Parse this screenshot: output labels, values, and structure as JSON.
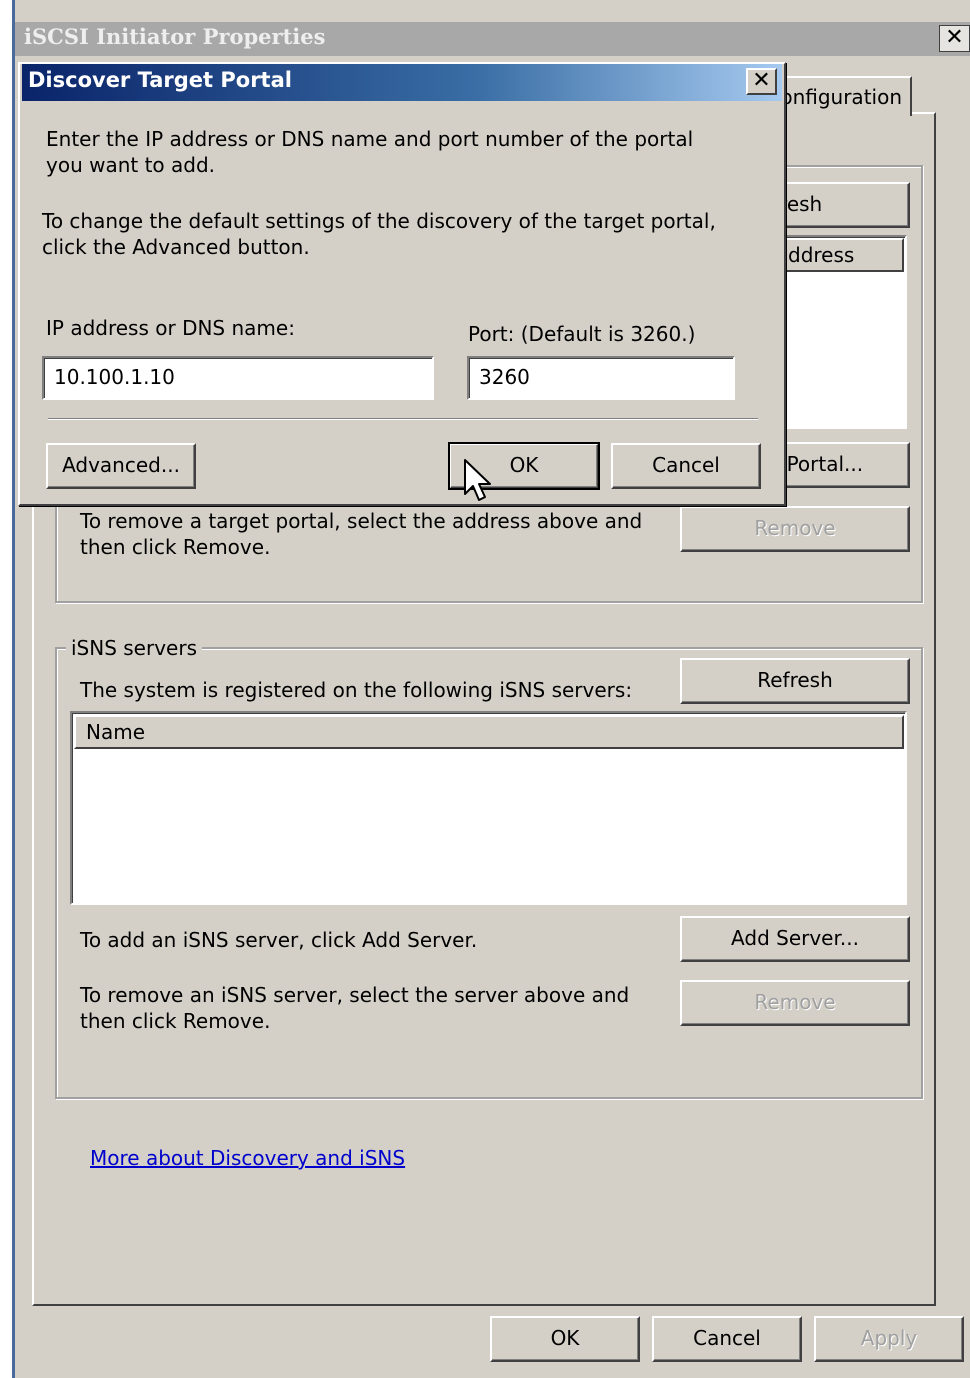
{
  "main_window": {
    "title": "iSCSI Initiator Properties",
    "close_glyph": "✕",
    "tab_label": "onfiguration",
    "targets_group": {
      "refresh_partial": "fresh",
      "column_partial": "ddress",
      "discover_portal_partial": "r Portal...",
      "remove_text": "To remove a target portal, select the address above and then click Remove.",
      "remove_button": "Remove"
    },
    "isns_group": {
      "legend": "iSNS servers",
      "registered_text": "The system is registered on the following iSNS servers:",
      "refresh_button": "Refresh",
      "column_name": "Name",
      "add_text": "To add an iSNS server, click Add Server.",
      "add_button": "Add Server...",
      "remove_text": "To remove an iSNS server, select the server above and then click Remove.",
      "remove_button": "Remove"
    },
    "link_more": "More about Discovery and iSNS",
    "buttons": {
      "ok": "OK",
      "cancel": "Cancel",
      "apply": "Apply"
    }
  },
  "dialog": {
    "title": "Discover Target Portal",
    "close_glyph": "✕",
    "intro_text": "Enter the IP address or DNS name and port number of the portal you want to add.",
    "advanced_text": "To change the default settings of the discovery of the target portal, click the Advanced button.",
    "ip_label": "IP address or DNS name:",
    "ip_value": "10.100.1.10",
    "port_label": "Port: (Default is 3260.)",
    "port_value": "3260",
    "buttons": {
      "advanced": "Advanced...",
      "ok": "OK",
      "cancel": "Cancel"
    }
  },
  "colors": {
    "dialog_title_start": "#0a246a",
    "dialog_title_end": "#a6caf0",
    "window_bg": "#d4d0c8",
    "link": "#0000cc"
  },
  "icons": {
    "cursor": "arrow-pointer-icon"
  }
}
